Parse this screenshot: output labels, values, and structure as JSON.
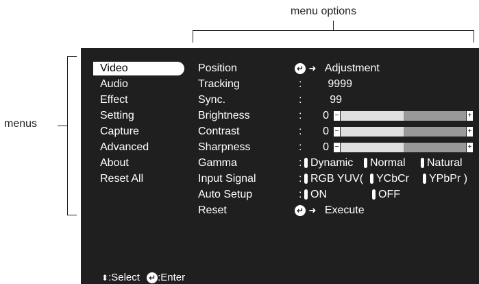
{
  "annotations": {
    "menu_options": "menu options",
    "menus": "menus"
  },
  "menus": [
    "Video",
    "Audio",
    "Effect",
    "Setting",
    "Capture",
    "Advanced",
    "About",
    "Reset All"
  ],
  "active_menu_index": 0,
  "options": {
    "position": {
      "label": "Position",
      "value": "Adjustment"
    },
    "tracking": {
      "label": "Tracking",
      "colon": ":",
      "value": "9999"
    },
    "sync": {
      "label": "Sync.",
      "colon": ":",
      "value": "99"
    },
    "brightness": {
      "label": "Brightness",
      "colon": ":",
      "value": "0",
      "level": 0.5
    },
    "contrast": {
      "label": "Contrast",
      "colon": ":",
      "value": "0",
      "level": 0.5
    },
    "sharpness": {
      "label": "Sharpness",
      "colon": ":",
      "value": "0",
      "level": 0.5
    },
    "gamma": {
      "label": "Gamma",
      "colon": ":",
      "choices": [
        "Dynamic",
        "Normal",
        "Natural"
      ]
    },
    "input_signal": {
      "label": "Input Signal",
      "colon": ":",
      "prefix": "RGB YUV(",
      "choices": [
        "YCbCr",
        "YPbPr )"
      ]
    },
    "auto_setup": {
      "label": "Auto Setup",
      "colon": ":",
      "choices": [
        "ON",
        "OFF"
      ]
    },
    "reset": {
      "label": "Reset",
      "value": "Execute"
    }
  },
  "footer": {
    "select": ":Select",
    "enter": ":Enter"
  },
  "icons": {
    "enter": "enter-icon",
    "arrow": "arrow-right-icon",
    "updown": "up-down-arrows-icon",
    "slider_minus": "minus-icon",
    "slider_plus": "plus-icon"
  }
}
